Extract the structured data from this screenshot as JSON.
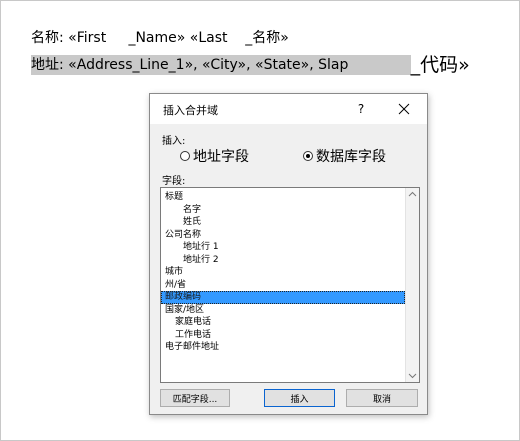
{
  "document": {
    "line1": "名称: «First     _Name» «Last    _名称»",
    "line2_highlighted": "地址: «Address_Line_1», «City», «State», Slap              ",
    "line2_tail": "_代码»"
  },
  "dialog": {
    "title": "插入合并域",
    "help_label": "?",
    "insert_label": "插入:",
    "radio_address": "地址字段",
    "radio_database": "数据库字段",
    "fields_label": "字段:",
    "selected_radio": "database",
    "fields": [
      {
        "label": "标题",
        "indent": 0
      },
      {
        "label": "名字",
        "indent": 1
      },
      {
        "label": "姓氏",
        "indent": 1
      },
      {
        "label": "公司名称",
        "indent": 0
      },
      {
        "label": "地址行 1",
        "indent": 1
      },
      {
        "label": "地址行 2",
        "indent": 1
      },
      {
        "label": "城市",
        "indent": 0
      },
      {
        "label": "州/省",
        "indent": 0
      },
      {
        "label": "邮政编码",
        "indent": 0,
        "selected": true
      },
      {
        "label": "国家/地区",
        "indent": 0
      },
      {
        "label": "家庭电话",
        "indent": 2
      },
      {
        "label": "工作电话",
        "indent": 2
      },
      {
        "label": "电子邮件地址",
        "indent": 0
      }
    ],
    "buttons": {
      "match_fields": "匹配字段...",
      "insert": "插入",
      "cancel": "取消"
    }
  },
  "colors": {
    "selection": "#3399ff",
    "default_button_border": "#0a64d0",
    "highlight": "#c9c9c9"
  }
}
